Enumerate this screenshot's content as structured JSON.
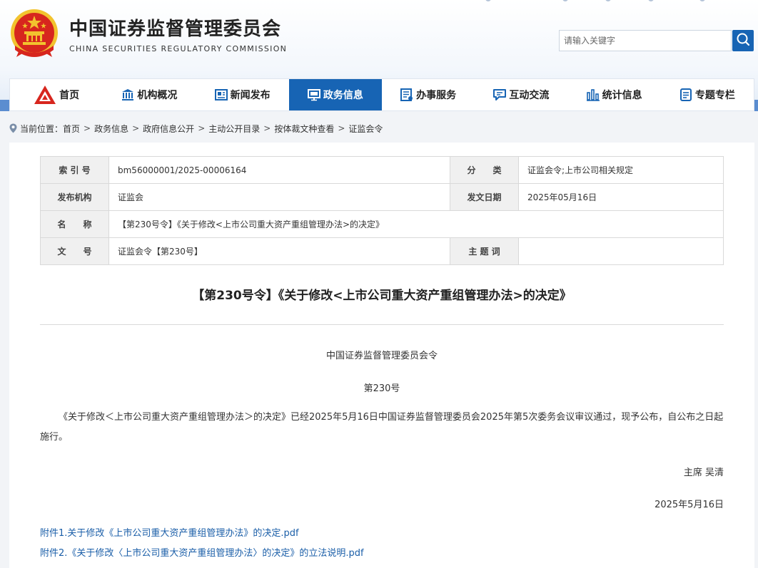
{
  "header": {
    "site_name_cn": "中国证券监督管理委员会",
    "site_name_en": "CHINA SECURITIES REGULATORY COMMISSION",
    "search_placeholder": "请输入关键字"
  },
  "nav": {
    "items": [
      {
        "label": "首页",
        "icon": "logo-icon"
      },
      {
        "label": "机构概况",
        "icon": "building-icon"
      },
      {
        "label": "新闻发布",
        "icon": "news-icon"
      },
      {
        "label": "政务信息",
        "icon": "monitor-icon"
      },
      {
        "label": "办事服务",
        "icon": "service-icon"
      },
      {
        "label": "互动交流",
        "icon": "chat-icon"
      },
      {
        "label": "统计信息",
        "icon": "bar-chart-icon"
      },
      {
        "label": "专题专栏",
        "icon": "document-icon"
      }
    ],
    "active_index": 3
  },
  "breadcrumb": {
    "prefix": "当前位置：",
    "items": [
      "首页",
      "政务信息",
      "政府信息公开",
      "主动公开目录",
      "按体裁文种查看",
      "证监会令"
    ],
    "separator": ">"
  },
  "meta_table": {
    "rows": [
      {
        "label1": "索 引 号",
        "value1": "bm56000001/2025-00006164",
        "label2": "分　　类",
        "value2": "证监会令;上市公司相关规定"
      },
      {
        "label1": "发布机构",
        "value1": "证监会",
        "label2": "发文日期",
        "value2": "2025年05月16日"
      },
      {
        "label1": "名　　称",
        "value1": "【第230号令】《关于修改<上市公司重大资产重组管理办法>的决定》"
      },
      {
        "label1": "文　　号",
        "value1": "证监会令【第230号】",
        "label2": "主 题 词",
        "value2": ""
      }
    ]
  },
  "document": {
    "title": "【第230号令】《关于修改<上市公司重大资产重组管理办法>的决定》",
    "issuer": "中国证券监督管理委员会令",
    "number": "第230号",
    "body": "《关于修改＜上市公司重大资产重组管理办法＞的决定》已经2025年5月16日中国证券监督管理委员会2025年第5次委务会议审议通过，现予公布，自公布之日起施行。",
    "signatory": "主席  吴清",
    "date": "2025年5月16日"
  },
  "attachments": [
    "附件1.关于修改《上市公司重大资产重组管理办法》的决定.pdf",
    "附件2.《关于修改〈上市公司重大资产重组管理办法〉的决定》的立法说明.pdf"
  ],
  "colors": {
    "brand_blue": "#1764b4",
    "link_blue": "#1a5ea8",
    "emblem_red": "#d7261e",
    "emblem_gold": "#f2c32e"
  }
}
